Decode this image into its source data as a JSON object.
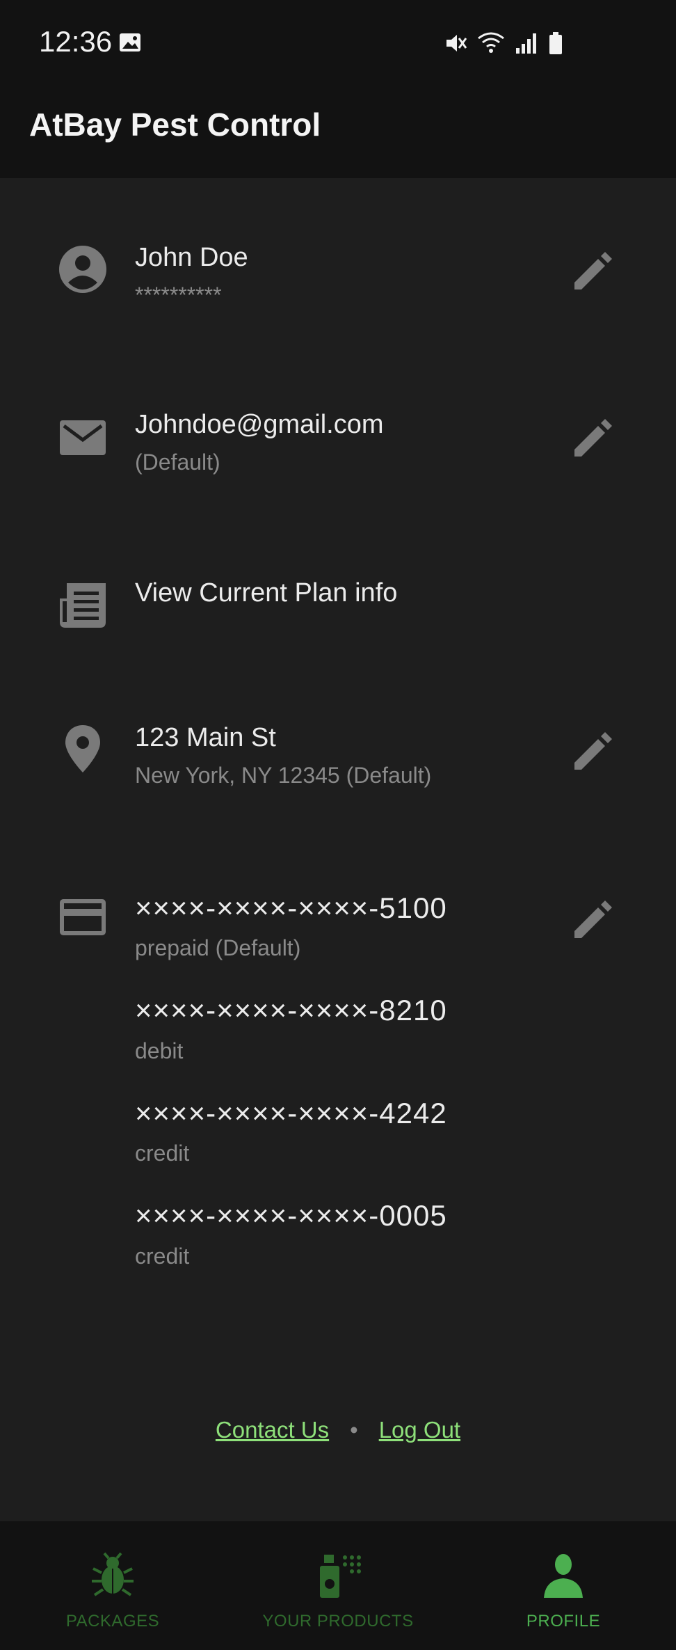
{
  "status_bar": {
    "time": "12:36"
  },
  "app_bar": {
    "title": "AtBay Pest Control"
  },
  "profile": {
    "name": "John Doe",
    "password_mask": "**********"
  },
  "email": {
    "address": "Johndoe@gmail.com",
    "note": "(Default)"
  },
  "plan": {
    "label": "View Current Plan info"
  },
  "address": {
    "street": "123 Main St",
    "city_line": "New York, NY 12345 (Default)"
  },
  "cards": [
    {
      "number": "××××-××××-××××-5100",
      "type": "prepaid (Default)"
    },
    {
      "number": "××××-××××-××××-8210",
      "type": "debit"
    },
    {
      "number": "××××-××××-××××-4242",
      "type": "credit"
    },
    {
      "number": "××××-××××-××××-0005",
      "type": "credit"
    }
  ],
  "footer": {
    "contact_label": "Contact Us",
    "separator": "•",
    "logout_label": "Log Out"
  },
  "bottom_nav": [
    {
      "label": "PACKAGES",
      "icon": "bug-icon",
      "active": false
    },
    {
      "label": "YOUR PRODUCTS",
      "icon": "spray-bottle-icon",
      "active": false
    },
    {
      "label": "PROFILE",
      "icon": "person-icon",
      "active": true
    }
  ],
  "colors": {
    "background": "#1e1e1e",
    "bar": "#121212",
    "accent_green": "#4caf50",
    "link_green": "#8ee07a",
    "icon_gray": "#7a7a7a"
  }
}
